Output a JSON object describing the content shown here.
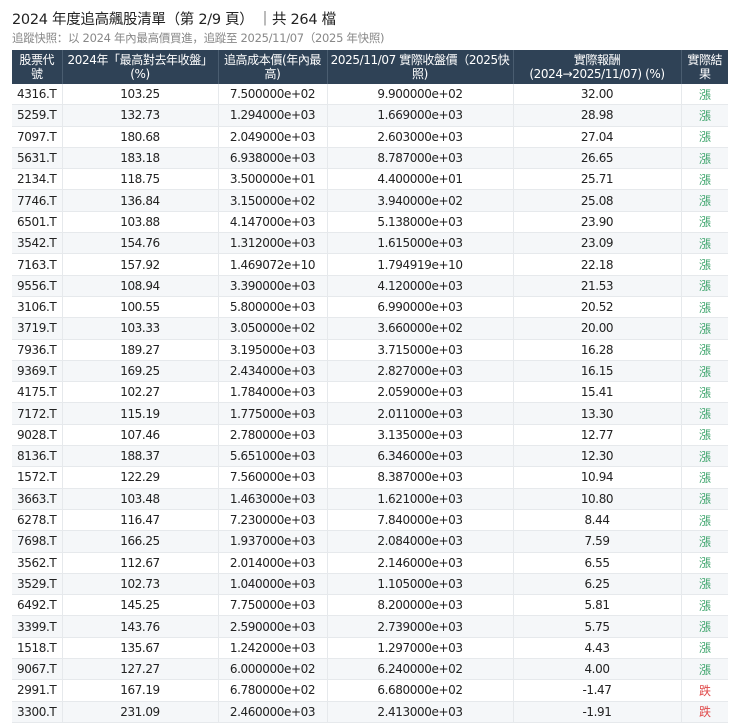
{
  "header": {
    "title": "2024 年度追高飆股清單（第 2/9 頁） ｜共 264 檔",
    "subtitle": "追蹤快照：以 2024 年內最高價買進，追蹤至 2025/11/07（2025 年快照)"
  },
  "colors": {
    "header_bg": "#2f4256",
    "up": "#3aa36a",
    "down": "#e04a4a"
  },
  "table": {
    "columns": [
      "股票代號",
      "2024年「最高對去年收盤」(%)",
      "追高成本價(年內最高)",
      "2025/11/07 實際收盤價（2025快照)",
      "實際報酬 (2024→2025/11/07) (%)",
      "實際結果"
    ],
    "rows": [
      [
        "4316.T",
        "103.25",
        "7.500000e+02",
        "9.900000e+02",
        "32.00",
        "漲"
      ],
      [
        "5259.T",
        "132.73",
        "1.294000e+03",
        "1.669000e+03",
        "28.98",
        "漲"
      ],
      [
        "7097.T",
        "180.68",
        "2.049000e+03",
        "2.603000e+03",
        "27.04",
        "漲"
      ],
      [
        "5631.T",
        "183.18",
        "6.938000e+03",
        "8.787000e+03",
        "26.65",
        "漲"
      ],
      [
        "2134.T",
        "118.75",
        "3.500000e+01",
        "4.400000e+01",
        "25.71",
        "漲"
      ],
      [
        "7746.T",
        "136.84",
        "3.150000e+02",
        "3.940000e+02",
        "25.08",
        "漲"
      ],
      [
        "6501.T",
        "103.88",
        "4.147000e+03",
        "5.138000e+03",
        "23.90",
        "漲"
      ],
      [
        "3542.T",
        "154.76",
        "1.312000e+03",
        "1.615000e+03",
        "23.09",
        "漲"
      ],
      [
        "7163.T",
        "157.92",
        "1.469072e+10",
        "1.794919e+10",
        "22.18",
        "漲"
      ],
      [
        "9556.T",
        "108.94",
        "3.390000e+03",
        "4.120000e+03",
        "21.53",
        "漲"
      ],
      [
        "3106.T",
        "100.55",
        "5.800000e+03",
        "6.990000e+03",
        "20.52",
        "漲"
      ],
      [
        "3719.T",
        "103.33",
        "3.050000e+02",
        "3.660000e+02",
        "20.00",
        "漲"
      ],
      [
        "7936.T",
        "189.27",
        "3.195000e+03",
        "3.715000e+03",
        "16.28",
        "漲"
      ],
      [
        "9369.T",
        "169.25",
        "2.434000e+03",
        "2.827000e+03",
        "16.15",
        "漲"
      ],
      [
        "4175.T",
        "102.27",
        "1.784000e+03",
        "2.059000e+03",
        "15.41",
        "漲"
      ],
      [
        "7172.T",
        "115.19",
        "1.775000e+03",
        "2.011000e+03",
        "13.30",
        "漲"
      ],
      [
        "9028.T",
        "107.46",
        "2.780000e+03",
        "3.135000e+03",
        "12.77",
        "漲"
      ],
      [
        "8136.T",
        "188.37",
        "5.651000e+03",
        "6.346000e+03",
        "12.30",
        "漲"
      ],
      [
        "1572.T",
        "122.29",
        "7.560000e+03",
        "8.387000e+03",
        "10.94",
        "漲"
      ],
      [
        "3663.T",
        "103.48",
        "1.463000e+03",
        "1.621000e+03",
        "10.80",
        "漲"
      ],
      [
        "6278.T",
        "116.47",
        "7.230000e+03",
        "7.840000e+03",
        "8.44",
        "漲"
      ],
      [
        "7698.T",
        "166.25",
        "1.937000e+03",
        "2.084000e+03",
        "7.59",
        "漲"
      ],
      [
        "3562.T",
        "112.67",
        "2.014000e+03",
        "2.146000e+03",
        "6.55",
        "漲"
      ],
      [
        "3529.T",
        "102.73",
        "1.040000e+03",
        "1.105000e+03",
        "6.25",
        "漲"
      ],
      [
        "6492.T",
        "145.25",
        "7.750000e+03",
        "8.200000e+03",
        "5.81",
        "漲"
      ],
      [
        "3399.T",
        "143.76",
        "2.590000e+03",
        "2.739000e+03",
        "5.75",
        "漲"
      ],
      [
        "1518.T",
        "135.67",
        "1.242000e+03",
        "1.297000e+03",
        "4.43",
        "漲"
      ],
      [
        "9067.T",
        "127.27",
        "6.000000e+02",
        "6.240000e+02",
        "4.00",
        "漲"
      ],
      [
        "2991.T",
        "167.19",
        "6.780000e+02",
        "6.680000e+02",
        "-1.47",
        "跌"
      ],
      [
        "3300.T",
        "231.09",
        "2.460000e+03",
        "2.413000e+03",
        "-1.91",
        "跌"
      ]
    ]
  }
}
